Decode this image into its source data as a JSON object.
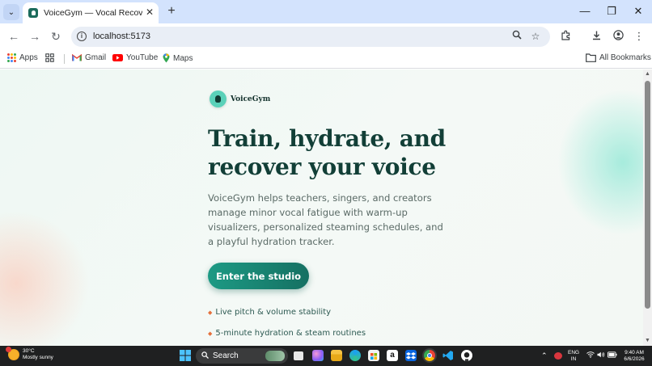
{
  "browser": {
    "tab": {
      "title": "VoiceGym — Vocal Recovery St",
      "close_label": "✕"
    },
    "new_tab_label": "+",
    "window_controls": {
      "minimize": "—",
      "restore": "❐",
      "close": "✕"
    },
    "nav": {
      "back": "←",
      "forward": "→",
      "reload": "↻"
    },
    "omnibox": {
      "url": "localhost:5173",
      "info_icon": "i"
    },
    "bookmarks": [
      {
        "label": "Apps",
        "icon": "apps-grid-icon"
      },
      {
        "label": "Gmail",
        "icon": "gmail-icon"
      },
      {
        "label": "YouTube",
        "icon": "youtube-icon"
      },
      {
        "label": "Maps",
        "icon": "maps-icon"
      }
    ],
    "all_bookmarks_label": "All Bookmarks"
  },
  "page": {
    "brand": {
      "name": "VoiceGym"
    },
    "headline": "Train, hydrate, and recover your voice",
    "lead": "VoiceGym helps teachers, singers, and creators manage minor vocal fatigue with warm-up visualizers, personalized steaming schedules, and a playful hydration tracker.",
    "cta_label": "Enter the studio",
    "features": [
      "Live pitch & volume stability",
      "5-minute hydration & steam routines"
    ],
    "colors": {
      "accent": "#1d9a84",
      "heading": "#123f37",
      "bullet": "#e4703c"
    }
  },
  "taskbar": {
    "weather": {
      "temp": "30°C",
      "condition": "Mostly sunny"
    },
    "search_label": "Search",
    "language": {
      "lang": "ENG",
      "region": "IN"
    },
    "clock": {
      "time": "9:40 AM",
      "date": "6/6/2026"
    }
  }
}
